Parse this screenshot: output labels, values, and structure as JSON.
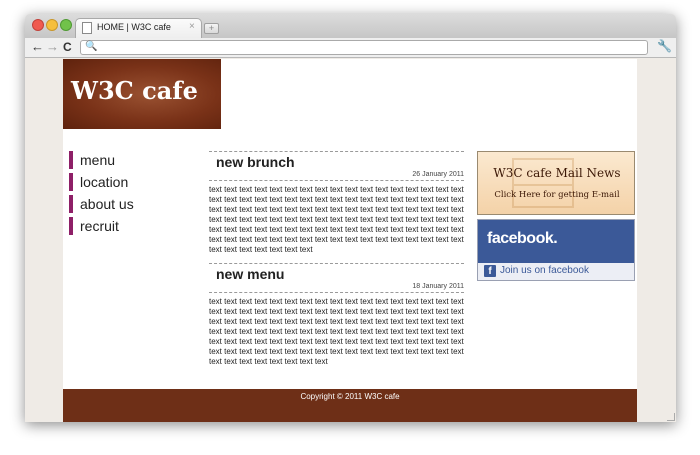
{
  "browser": {
    "tab_title": "HOME | W3C cafe",
    "tab_close": "×",
    "new_tab": "+",
    "address_value": "",
    "back_icon": "←",
    "forward_icon": "→",
    "reload_icon": "C",
    "search_icon": "🔍",
    "wrench_icon": "🔧"
  },
  "site": {
    "logo": "W3C cafe",
    "menu": [
      {
        "label": "menu"
      },
      {
        "label": "location"
      },
      {
        "label": "about us"
      },
      {
        "label": "recruit"
      }
    ],
    "articles": [
      {
        "title": "new brunch",
        "date": "26 January 2011",
        "body": "text text text text text text text text text text text text text text text text text text text text text text text text text text text text text text text text text text text text text text text text text text text text text text text text text text text text text text text text text text text text text text text text text text text text text text text text text text text text text text text text text text text text text text text text text text text text text text text text text text text text text text text text text text text text text"
      },
      {
        "title": "new menu",
        "date": "18 January 2011",
        "body": "text text text text text text text text text text text text text text text text text text text text text text text text text text text text text text text text text text text text text text text text text text text text text text text text text text text text text text text text text text text text text text text text text text text text text text text text text text text text text text text text text text text text text text text text text text text text text text text text text text text text text text text text text text text text text text"
      }
    ],
    "mail_banner": {
      "title": "W3C cafe Mail News",
      "subtitle": "Click Here for getting E-mail"
    },
    "facebook_banner": {
      "logo": "facebook.",
      "icon_letter": "f",
      "link": "Join us on facebook"
    },
    "footer": "Copyright © 2011 W3C cafe"
  },
  "colors": {
    "logo_bg": "#7a3218",
    "menu_bar": "#8e1f67",
    "footer_bg": "#6e2f17",
    "facebook_blue": "#3b5998",
    "page_bg": "#efebe6"
  }
}
